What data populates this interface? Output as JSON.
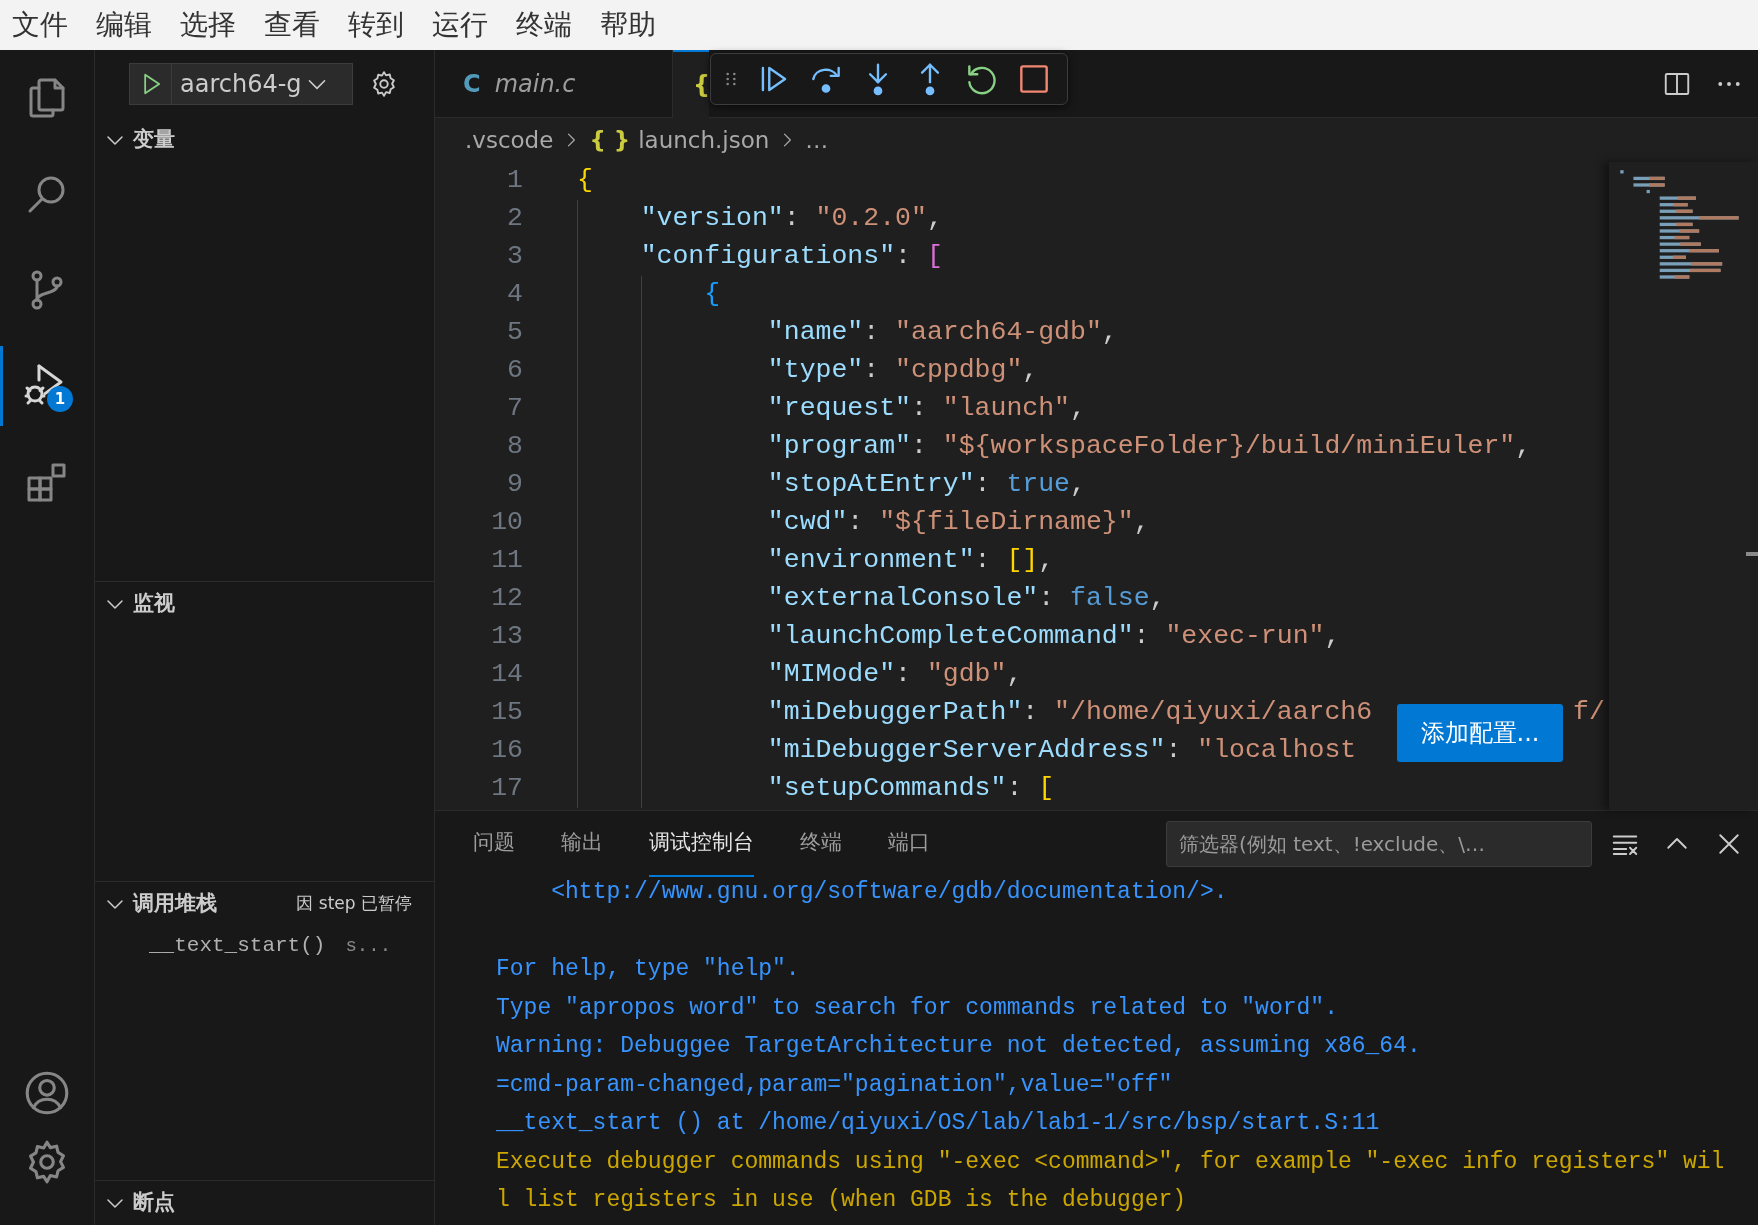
{
  "menu_bar": {
    "items": [
      "文件",
      "编辑",
      "选择",
      "查看",
      "转到",
      "运行",
      "终端",
      "帮助"
    ]
  },
  "activity_bar": {
    "items": [
      {
        "kind": "files",
        "selected": false
      },
      {
        "kind": "search",
        "selected": false
      },
      {
        "kind": "source-control",
        "selected": false
      },
      {
        "kind": "run-debug",
        "selected": true,
        "badge": "1"
      },
      {
        "kind": "extensions",
        "selected": false
      }
    ],
    "bottom": [
      {
        "kind": "account"
      },
      {
        "kind": "manage"
      }
    ]
  },
  "sidebar": {
    "run_config": "aarch64-g",
    "sections": [
      {
        "title": "变量",
        "expanded": true
      },
      {
        "title": "监视",
        "expanded": true
      },
      {
        "title": "调用堆栈",
        "expanded": true,
        "status": "因 step 已暂停",
        "frames": [
          {
            "function": "__text_start()",
            "source": "s..."
          }
        ]
      },
      {
        "title": "断点",
        "expanded": true
      }
    ]
  },
  "editor": {
    "tabs": [
      {
        "icon": "C",
        "label": "main.c",
        "selected": false
      },
      {
        "icon": "{",
        "selected": true
      }
    ],
    "debug_toolbar": [
      {
        "kind": "continue"
      },
      {
        "kind": "step-over"
      },
      {
        "kind": "step-into"
      },
      {
        "kind": "step-out"
      },
      {
        "kind": "restart"
      },
      {
        "kind": "stop"
      }
    ],
    "breadcrumb": [
      {
        "label": ".vscode"
      },
      {
        "icon": "{ }",
        "label": "launch.json"
      },
      {
        "label": "…"
      }
    ],
    "lines": [
      {
        "number": "1",
        "text": "{"
      },
      {
        "number": "2",
        "text": "    \"version\": \"0.2.0\","
      },
      {
        "number": "3",
        "text": "    \"configurations\": ["
      },
      {
        "number": "4",
        "text": "        {"
      },
      {
        "number": "5",
        "text": "            \"name\": \"aarch64-gdb\","
      },
      {
        "number": "6",
        "text": "            \"type\": \"cppdbg\","
      },
      {
        "number": "7",
        "text": "            \"request\": \"launch\","
      },
      {
        "number": "8",
        "text": "            \"program\": \"${workspaceFolder}/build/miniEuler\","
      },
      {
        "number": "9",
        "text": "            \"stopAtEntry\": true,"
      },
      {
        "number": "10",
        "text": "            \"cwd\": \"${fileDirname}\","
      },
      {
        "number": "11",
        "text": "            \"environment\": [],"
      },
      {
        "number": "12",
        "text": "            \"externalConsole\": false,"
      },
      {
        "number": "13",
        "text": "            \"launchCompleteCommand\": \"exec-run\","
      },
      {
        "number": "14",
        "text": "            \"MIMode\": \"gdb\","
      },
      {
        "number": "15",
        "text": "            \"miDebuggerPath\": \"/home/qiyuxi/aarch6",
        "tail": "f/"
      },
      {
        "number": "16",
        "text": "            \"miDebuggerServerAddress\": \"localhost"
      },
      {
        "number": "17",
        "text": "            \"setupCommands\": ["
      }
    ],
    "overlay_button": "添加配置..."
  },
  "panel": {
    "tabs": [
      {
        "label": "问题",
        "selected": false
      },
      {
        "label": "输出",
        "selected": false
      },
      {
        "label": "调试控制台",
        "selected": true
      },
      {
        "label": "终端",
        "selected": false
      },
      {
        "label": "端口",
        "selected": false
      }
    ],
    "filter": {
      "placeholder": "筛选器(例如 text、!exclude、\\…"
    },
    "console": [
      {
        "lines": [
          {
            "kind": "info",
            "text": "    <http://www.gnu.org/software/gdb/documentation/>."
          }
        ]
      },
      {
        "lines": [
          {
            "kind": "info",
            "text": "For help, type \"help\"."
          },
          {
            "kind": "info",
            "text": "Type \"apropos word\" to search for commands related to \"word\"."
          },
          {
            "kind": "info",
            "text": "Warning: Debuggee TargetArchitecture not detected, assuming x86_64."
          },
          {
            "kind": "info",
            "text": "=cmd-param-changed,param=\"pagination\",value=\"off\""
          },
          {
            "kind": "info",
            "text": "__text_start () at /home/qiyuxi/OS/lab/lab1-1/src/bsp/start.S:11"
          },
          {
            "kind": "warning",
            "text": "Execute debugger commands using \"-exec <command>\", for example \"-exec info registers\" will list registers in use (when GDB is the debugger)"
          }
        ]
      }
    ]
  }
}
